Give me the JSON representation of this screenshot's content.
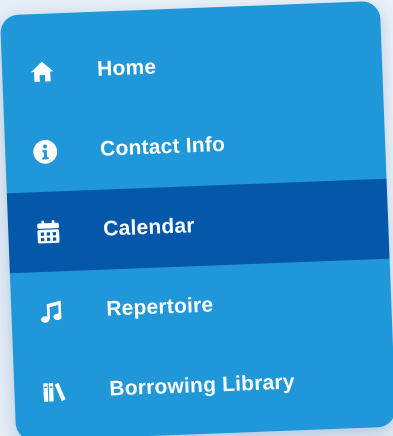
{
  "nav": {
    "items": [
      {
        "label": "Home",
        "icon": "home-icon"
      },
      {
        "label": "Contact Info",
        "icon": "info-icon"
      },
      {
        "label": "Calendar",
        "icon": "calendar-icon",
        "active": true
      },
      {
        "label": "Repertoire",
        "icon": "music-note-icon"
      },
      {
        "label": "Borrowing Library",
        "icon": "books-icon"
      }
    ]
  },
  "colors": {
    "panel": "#1f97d8",
    "active": "#0557aa",
    "text": "#ffffff"
  }
}
